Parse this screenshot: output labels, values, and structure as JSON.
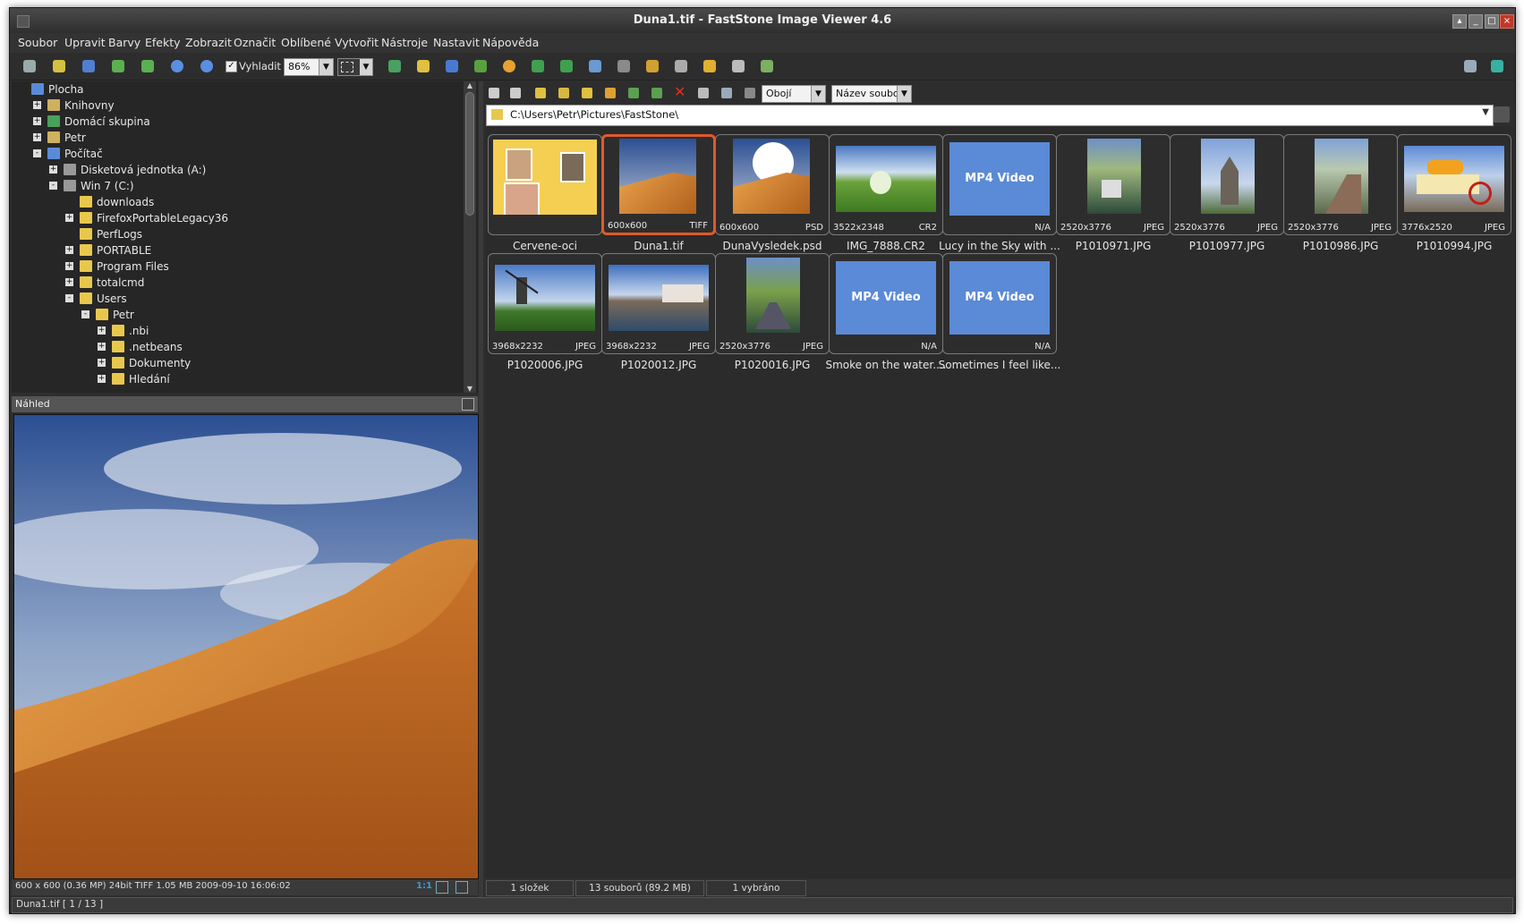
{
  "window": {
    "title": "Duna1.tif  -  FastStone Image Viewer 4.6",
    "controls": [
      "restore-up",
      "minimize",
      "maximize",
      "close"
    ]
  },
  "menu": [
    "Soubor",
    "Upravit",
    "Barvy",
    "Efekty",
    "Zobrazit",
    "Označit",
    "Oblíbené",
    "Vytvořit",
    "Nástroje",
    "Nastavit",
    "Nápověda"
  ],
  "toolbar": {
    "smooth_label": "Vyhladit",
    "smooth_checked": true,
    "zoom_value": "86%"
  },
  "tree": [
    {
      "label": "Plocha",
      "icon": "desktop-icon",
      "level": 0,
      "expander": ""
    },
    {
      "label": "Knihovny",
      "icon": "library-icon",
      "level": 1,
      "expander": "+"
    },
    {
      "label": "Domácí skupina",
      "icon": "homegroup-icon",
      "level": 1,
      "expander": "+"
    },
    {
      "label": "Petr",
      "icon": "user-folder-icon",
      "level": 1,
      "expander": "+"
    },
    {
      "label": "Počítač",
      "icon": "computer-icon",
      "level": 1,
      "expander": "-"
    },
    {
      "label": "Disketová jednotka (A:)",
      "icon": "floppy-icon",
      "level": 2,
      "expander": "+"
    },
    {
      "label": "Win 7 (C:)",
      "icon": "drive-icon",
      "level": 2,
      "expander": "-"
    },
    {
      "label": "downloads",
      "icon": "folder-icon",
      "level": 3,
      "expander": ""
    },
    {
      "label": "FirefoxPortableLegacy36",
      "icon": "folder-icon",
      "level": 3,
      "expander": "+"
    },
    {
      "label": "PerfLogs",
      "icon": "folder-icon",
      "level": 3,
      "expander": ""
    },
    {
      "label": "PORTABLE",
      "icon": "folder-icon",
      "level": 3,
      "expander": "+"
    },
    {
      "label": "Program Files",
      "icon": "folder-icon",
      "level": 3,
      "expander": "+"
    },
    {
      "label": "totalcmd",
      "icon": "folder-icon",
      "level": 3,
      "expander": "+"
    },
    {
      "label": "Users",
      "icon": "folder-icon",
      "level": 3,
      "expander": "-"
    },
    {
      "label": "Petr",
      "icon": "folder-icon",
      "level": 4,
      "expander": "-"
    },
    {
      "label": ".nbi",
      "icon": "folder-icon",
      "level": 5,
      "expander": "+"
    },
    {
      "label": ".netbeans",
      "icon": "folder-icon",
      "level": 5,
      "expander": "+"
    },
    {
      "label": "Dokumenty",
      "icon": "folder-icon",
      "level": 5,
      "expander": "+"
    },
    {
      "label": "Hledání",
      "icon": "folder-icon",
      "level": 5,
      "expander": "+"
    }
  ],
  "preview": {
    "header": "Náhled",
    "status": "600 x 600 (0.36 MP)  24bit  TIFF   1.05 MB   2009-09-10 16:06:02",
    "ratio_label": "1:1"
  },
  "browser": {
    "filter_value": "Obojí",
    "sort_value": "Název soubor",
    "path": "C:\\Users\\Petr\\Pictures\\FastStone\\"
  },
  "thumbnails": [
    {
      "name": "Cervene-oci",
      "dims": "",
      "type": "",
      "kind": "collage",
      "selected": false
    },
    {
      "name": "Duna1.tif",
      "dims": "600x600",
      "type": "TIFF",
      "kind": "dune",
      "selected": true
    },
    {
      "name": "DunaVysledek.psd",
      "dims": "600x600",
      "type": "PSD",
      "kind": "dune-sun",
      "selected": false
    },
    {
      "name": "IMG_7888.CR2",
      "dims": "3522x2348",
      "type": "CR2",
      "kind": "meadow",
      "selected": false
    },
    {
      "name": "Lucy in the Sky with ...",
      "dims": "",
      "type": "N/A",
      "kind": "video",
      "video_label": "MP4 Video",
      "selected": false
    },
    {
      "name": "P1010971.JPG",
      "dims": "2520x3776",
      "type": "JPEG",
      "kind": "canal-portrait",
      "selected": false
    },
    {
      "name": "P1010977.JPG",
      "dims": "2520x3776",
      "type": "JPEG",
      "kind": "church-portrait",
      "selected": false
    },
    {
      "name": "P1010986.JPG",
      "dims": "2520x3776",
      "type": "JPEG",
      "kind": "wall-portrait",
      "selected": false
    },
    {
      "name": "P1010994.JPG",
      "dims": "3776x2520",
      "type": "JPEG",
      "kind": "cart",
      "selected": false
    },
    {
      "name": "P1020006.JPG",
      "dims": "3968x2232",
      "type": "JPEG",
      "kind": "windmill",
      "selected": false
    },
    {
      "name": "P1020012.JPG",
      "dims": "3968x2232",
      "type": "JPEG",
      "kind": "river-city",
      "selected": false
    },
    {
      "name": "P1020016.JPG",
      "dims": "2520x3776",
      "type": "JPEG",
      "kind": "canal2-portrait",
      "selected": false
    },
    {
      "name": "Smoke on the water....",
      "dims": "",
      "type": "N/A",
      "kind": "video",
      "video_label": "MP4 Video",
      "selected": false
    },
    {
      "name": "Sometimes I feel like...",
      "dims": "",
      "type": "N/A",
      "kind": "video",
      "video_label": "MP4 Video",
      "selected": false
    }
  ],
  "status": {
    "folders": "1 složek",
    "files": "13 souborů (89.2 MB)",
    "selected": "1 vybráno",
    "bottom": "Duna1.tif [ 1 / 13 ]"
  },
  "colors": {
    "selection": "#e05a2b",
    "video_tile": "#5b8ad6",
    "background": "#2e2e2e"
  }
}
